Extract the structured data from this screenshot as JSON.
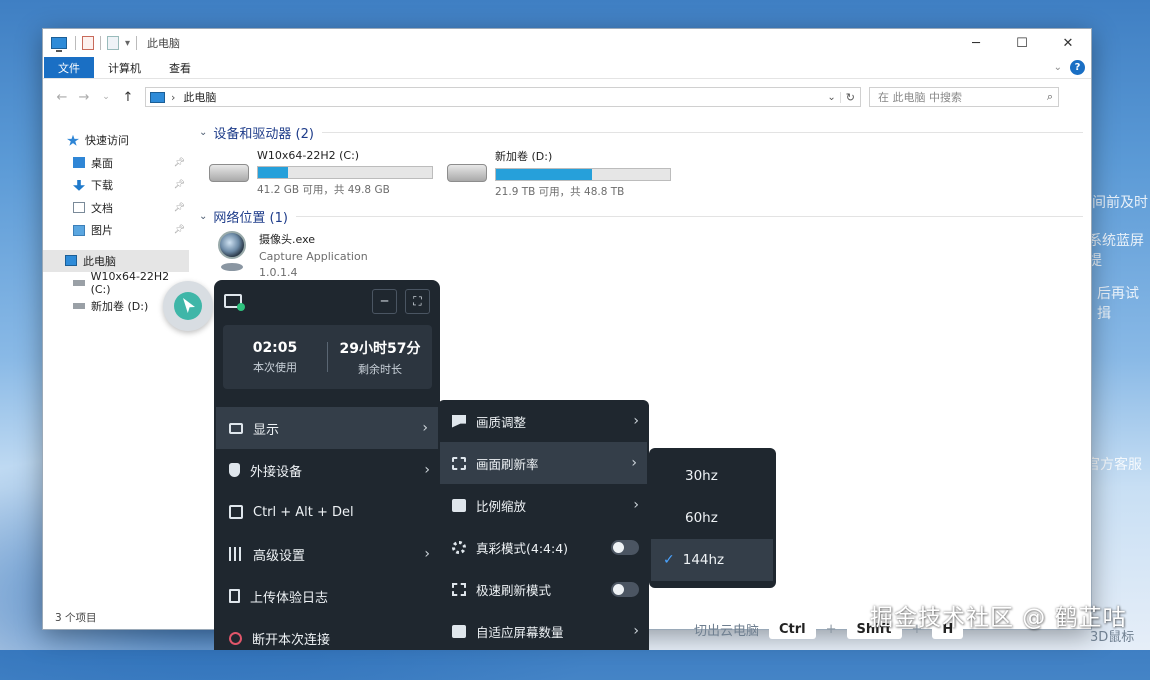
{
  "explorer": {
    "title": "此电脑",
    "ribbon_tabs": [
      "文件",
      "计算机",
      "查看"
    ],
    "address": "此电脑",
    "search_placeholder": "在 此电脑 中搜索",
    "sidebar": {
      "quick_access": "快速访问",
      "items": [
        "桌面",
        "下载",
        "文档",
        "图片"
      ],
      "this_pc": "此电脑",
      "drives": [
        "W10x64-22H2 (C:)",
        "新加卷 (D:)"
      ]
    },
    "devices_header": "设备和驱动器 (2)",
    "drives": [
      {
        "name": "W10x64-22H2 (C:)",
        "free": "41.2 GB 可用，共 49.8 GB",
        "used_fraction": 0.17
      },
      {
        "name": "新加卷 (D:)",
        "free": "21.9 TB 可用，共 48.8 TB",
        "used_fraction": 0.55
      }
    ],
    "network_header": "网络位置 (1)",
    "network_item": {
      "name": "摄像头.exe",
      "desc": "Capture Application",
      "version": "1.0.1.4"
    },
    "status": "3 个项目"
  },
  "background_text": [
    "间前及时",
    "系统蓝屏提",
    "后再试揖",
    "官方客服"
  ],
  "panel": {
    "session_time": "02:05",
    "session_label": "本次使用",
    "remaining_time": "29小时57分",
    "remaining_label": "剩余时长",
    "menu": [
      "显示",
      "外接设备",
      "Ctrl + Alt + Del",
      "高级设置",
      "上传体验日志",
      "断开本次连接"
    ]
  },
  "submenu": [
    "画质调整",
    "画面刷新率",
    "比例缩放",
    "真彩模式(4:4:4)",
    "极速刷新模式",
    "自适应屏幕数量"
  ],
  "hz": {
    "options": [
      "30hz",
      "60hz",
      "144hz"
    ],
    "selected": "144hz"
  },
  "shortcut": {
    "label": "切出云电脑",
    "keys": [
      "Ctrl",
      "Shift",
      "H"
    ],
    "extra": "3D鼠标"
  },
  "watermark": "掘金技术社区 @ 鹤芷咕",
  "colors": {
    "accent": "#1a6fc4",
    "progress": "#26a0da",
    "panel_bg": "#1f272f",
    "check": "#4aa3ff"
  }
}
